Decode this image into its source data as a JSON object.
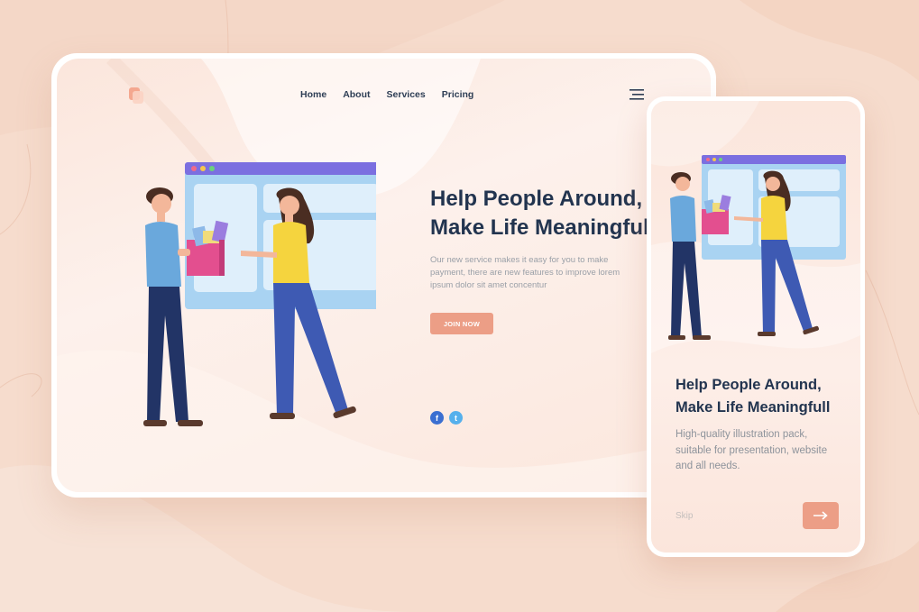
{
  "desktop": {
    "nav": {
      "home": "Home",
      "about": "About",
      "services": "Services",
      "pricing": "Pricing"
    },
    "hero": {
      "title_line1": "Help People Around,",
      "title_line2": "Make Life Meaningfull",
      "description": "Our new service makes it easy for you to make payment, there are new features to improve lorem ipsum dolor sit amet concentur",
      "cta_label": "JOIN NOW"
    },
    "social": {
      "facebook_glyph": "f",
      "twitter_glyph": "t"
    }
  },
  "mobile": {
    "title_line1": "Help People Around,",
    "title_line2": "Make Life Meaningfull",
    "description": "High-quality illustration pack, suitable for presentation, website and all needs.",
    "skip_label": "Skip",
    "next_icon": "arrow-right-icon"
  },
  "colors": {
    "background": "#f6dccd",
    "accent": "#ec9e86",
    "heading": "#22344f",
    "window_bar": "#7b6fe0",
    "window_panel": "#bfe0f7"
  }
}
